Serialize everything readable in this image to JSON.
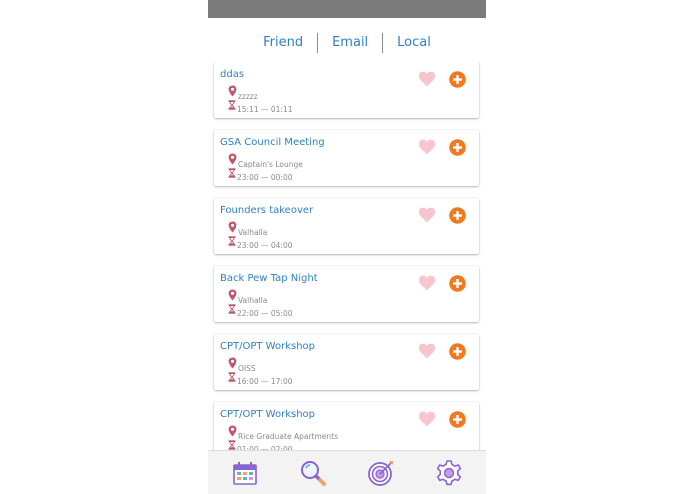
{
  "tabs": [
    "Friend",
    "Email",
    "Local"
  ],
  "events": [
    {
      "title": "ddas",
      "location": "zzzzz",
      "time": "15:11 — 01:11"
    },
    {
      "title": "GSA Council Meeting",
      "location": "Captain's Lounge",
      "time": "23:00 — 00:00"
    },
    {
      "title": "Founders takeover",
      "location": "Valhalla",
      "time": "23:00 — 04:00"
    },
    {
      "title": "Back Pew Tap Night",
      "location": "Valhalla",
      "time": "22:00 — 05:00"
    },
    {
      "title": "CPT/OPT Workshop",
      "location": "OISS",
      "time": "16:00 — 17:00"
    },
    {
      "title": "CPT/OPT Workshop",
      "location": "Rice Graduate Apartments",
      "time": "01:00 — 02:00"
    }
  ],
  "icons": {
    "location": "map-pin-icon",
    "time": "hourglass-icon",
    "favorite": "heart-icon",
    "add": "plus-circle-icon",
    "nav": [
      "calendar-grid-icon",
      "search-icon",
      "target-icon",
      "gear-icon"
    ]
  },
  "colors": {
    "accent_blue": "#2f7fc9",
    "add_orange": "#f07a1f",
    "heart_pink": "#f8c5cf",
    "pin_red": "#c0566a",
    "nav_purple": "#8a64d0",
    "status_bar": "#7b7b7b"
  }
}
